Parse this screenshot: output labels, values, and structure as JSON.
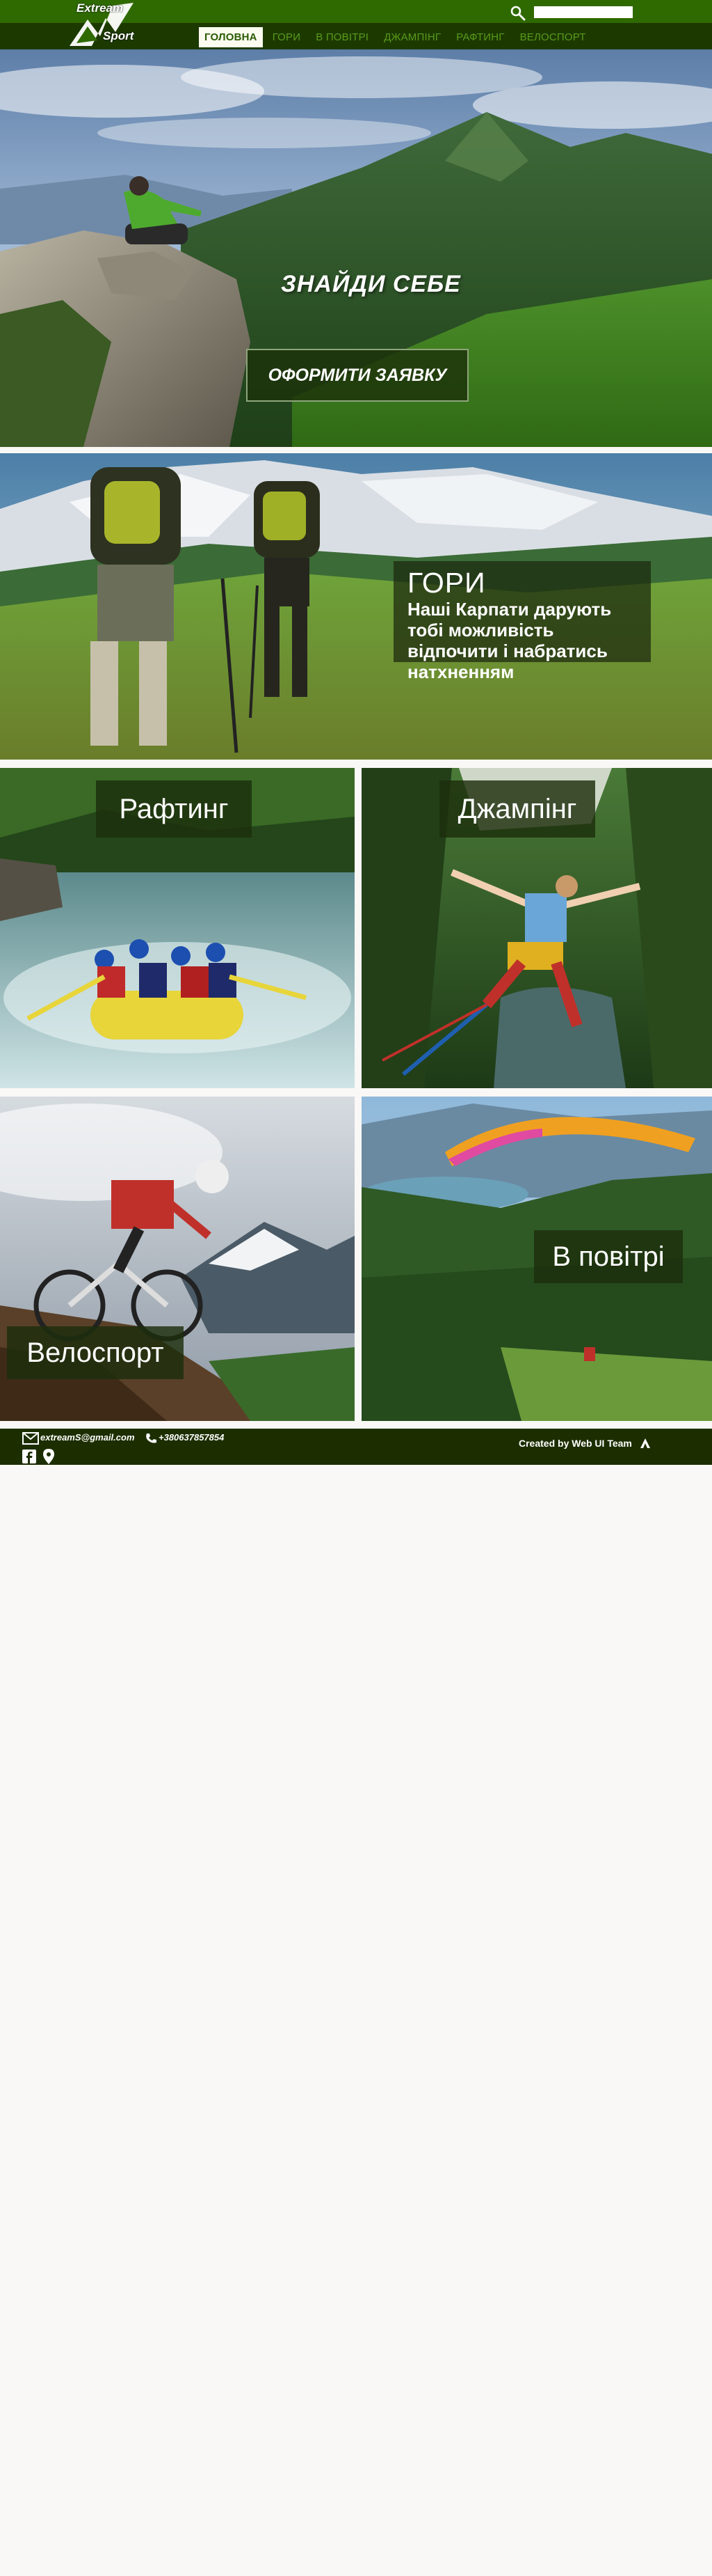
{
  "logo": {
    "line1": "Extream",
    "line2": "Sport"
  },
  "search": {
    "placeholder": ""
  },
  "nav": {
    "items": [
      {
        "label": "ГОЛОВНА"
      },
      {
        "label": "ГОРИ"
      },
      {
        "label": "В ПОВІТРІ"
      },
      {
        "label": "ДЖАМПІНГ"
      },
      {
        "label": "РАФТИНГ"
      },
      {
        "label": "ВЕЛОСПОРТ"
      }
    ],
    "active_index": 0
  },
  "hero": {
    "title": "ЗНАЙДИ СЕБЕ",
    "button_label": "ОФОРМИТИ ЗАЯВКУ",
    "slides": 2,
    "active_slide": 1
  },
  "mountains": {
    "title": "ГОРИ",
    "text": "Наші Карпати дарують тобі можливість відпочити і набратись натхненням"
  },
  "tiles": [
    {
      "label": "Рафтинг"
    },
    {
      "label": "Джампінг"
    },
    {
      "label": "Велоспорт"
    },
    {
      "label": "В повітрі"
    }
  ],
  "footer": {
    "email": "extreamS@gmail.com",
    "phone": "+380637857854",
    "credit": "Created by Web UI Team"
  },
  "icons": [
    "search-icon",
    "mail-icon",
    "phone-icon",
    "facebook-icon",
    "location-icon",
    "up-arrow-icon"
  ],
  "colors": {
    "topbar": "#2f6a00",
    "navbar": "#1c3a00",
    "footer": "#1c2e00",
    "nav_text": "#5a9a1c",
    "overlay": "#1c2e0c"
  }
}
